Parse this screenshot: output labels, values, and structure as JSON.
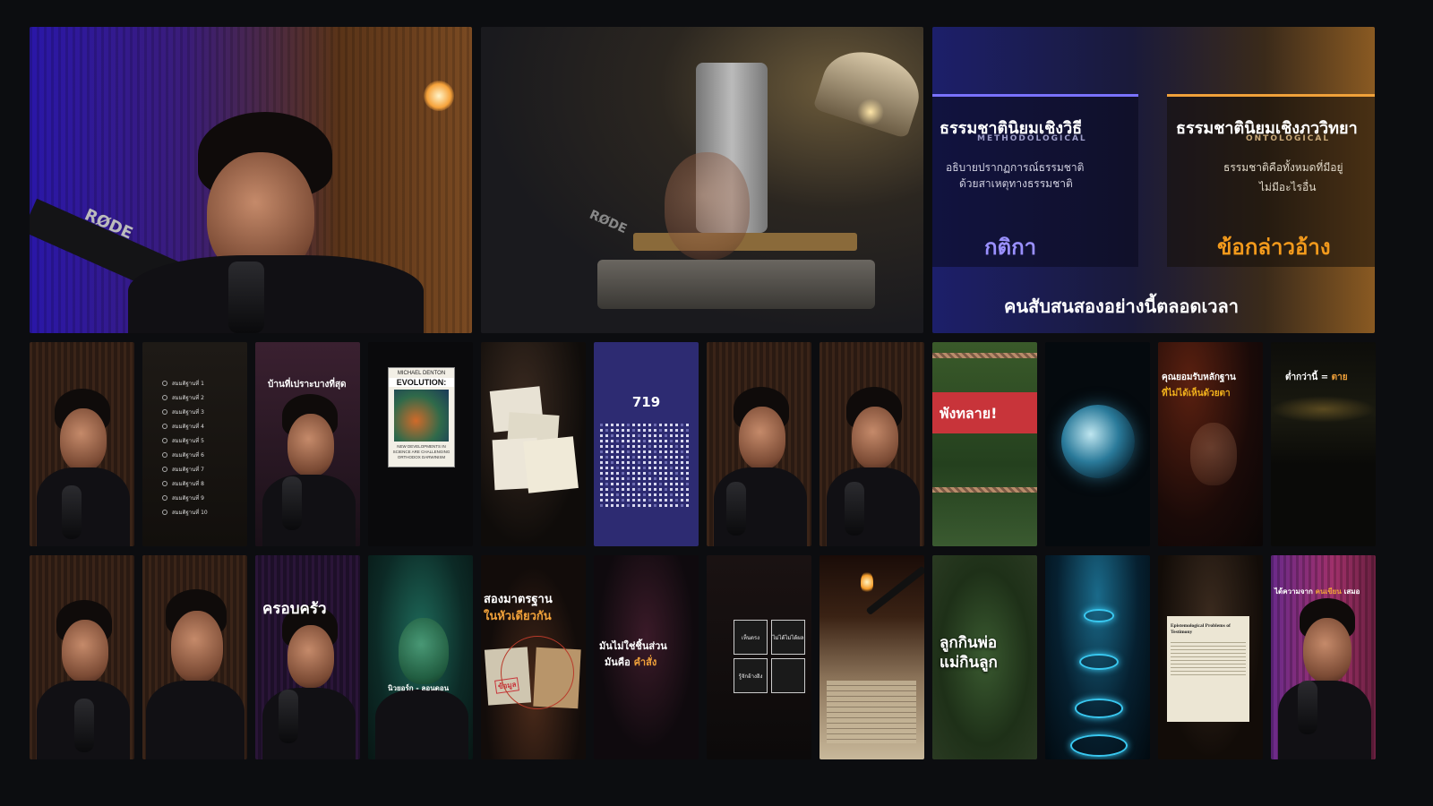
{
  "colors": {
    "background": "#0c0d10",
    "accent_purple": "#8c86ff",
    "accent_orange": "#f0a13a",
    "accent_red": "#c8343a",
    "accent_blue": "#39a7d8"
  },
  "row1": {
    "tile1": {
      "mic_brand": "RØDE"
    },
    "tile2": {
      "mic_brand": "RØDE"
    },
    "tile3": {
      "left_title": "ธรรมชาตินิยมเชิงวิธี",
      "left_subtitle": "METHODOLOGICAL",
      "left_desc_line1": "อธิบายปรากฏการณ์ธรรมชาติ",
      "left_desc_line2": "ด้วยสาเหตุทางธรรมชาติ",
      "left_keyword": "กติกา",
      "right_title": "ธรรมชาตินิยมเชิงภววิทยา",
      "right_subtitle": "ONTOLOGICAL",
      "right_desc_line1": "ธรรมชาติคือทั้งหมดที่มีอยู่",
      "right_desc_line2": "ไม่มีอะไรอื่น",
      "right_keyword": "ข้อกล่าวอ้าง",
      "caption": "คนสับสนสองอย่างนี้ตลอดเวลา"
    }
  },
  "row2": {
    "list_items": [
      "สมมติฐานที่ 1",
      "สมมติฐานที่ 2",
      "สมมติฐานที่ 3",
      "สมมติฐานที่ 4",
      "สมมติฐานที่ 5",
      "สมมติฐานที่ 6",
      "สมมติฐานที่ 7",
      "สมมติฐานที่ 8",
      "สมมติฐานที่ 9",
      "สมมติฐานที่ 10"
    ],
    "ironic_caption": "บ้านที่เปราะบางที่สุด",
    "book_author": "MICHAEL DENTON",
    "book_title": "EVOLUTION:",
    "book_subtitle": "NEW DEVELOPMENTS IN SCIENCE ARE CHALLENGING ORTHODOX DARWINISM",
    "grid_count": "719",
    "banner_text": "พังทลาย!",
    "accept_line1": "คุณยอมรับหลักฐาน",
    "accept_line2": "ที่ไม่ได้เห็นด้วยตา",
    "death_text_a": "ต่ำกว่านี้ = ",
    "death_text_b": "ตาย"
  },
  "row3": {
    "family_text": "ครอบครัว",
    "name_caption": "นิวยอร์ก - ลอนดอน",
    "double_std_line1": "สองมาตรฐาน",
    "double_std_line2": "ในหัวเดียวกัน",
    "stamp_text": "ข้อมูล",
    "not_part_line1": "มันไม่ใช่ชิ้นส่วน",
    "not_part_line2a": "มันคือ ",
    "not_part_line2b": "คำสั่ง",
    "matrix_cells": [
      "เห็นตรง",
      "ไม่ได้ไม่ได้ผล",
      "รู้จักอ้างอิง",
      ""
    ],
    "child_line1": "ลูกกินพ่อ",
    "child_line2": "แม่กินลูก",
    "paper_title": "Epistemological Problems of Testimony",
    "purple_caption_a": "ได้ความจาก ",
    "purple_caption_b": "คนเขียน",
    "purple_caption_c": " เสมอ"
  }
}
